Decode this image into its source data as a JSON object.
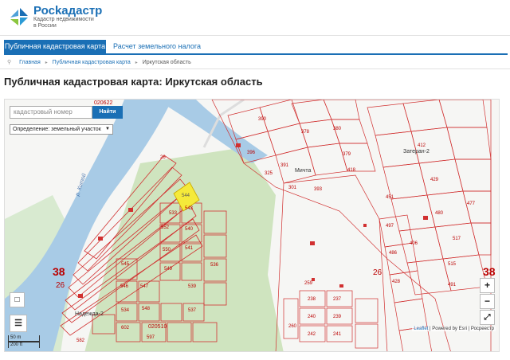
{
  "header": {
    "logo_title": "Росkадастр",
    "logo_sub_1": "Кадастр недвижимости",
    "logo_sub_2": "в России"
  },
  "nav": {
    "tabs": [
      {
        "label": "Публичная кадастровая карта",
        "active": true
      },
      {
        "label": "Расчет земельного налога",
        "active": false
      }
    ]
  },
  "breadcrumb": {
    "items": [
      "Главная",
      "Публичная кадастровая карта",
      "Иркутская область"
    ]
  },
  "page": {
    "title": "Публичная кадастровая карта: Иркутская область"
  },
  "map": {
    "search_placeholder": "кадастровый номер",
    "search_button": "Найти",
    "definition_label": "Определение:  земельный участок",
    "zoom_in": "+",
    "zoom_out": "−",
    "fullscreen": "⤢",
    "layers_icon": "layers-icon",
    "square_icon": "square-select-icon",
    "labels": {
      "big_left": "38",
      "big_left_sub": "26",
      "big_mid_sub": "26",
      "big_right": "38",
      "big_right_sub": "26",
      "top_code": "020622",
      "bottom_code": "020510",
      "river": "р. Китой",
      "village_1": "Мичта",
      "village_2": "Надежда-2",
      "village_3": "Затеран-2"
    },
    "scale_1": "50 m",
    "scale_2": "200 ft",
    "attribution_leaflet": "Leaflet",
    "attribution_rest": " | Powered by Esri | Росреестр",
    "parcels_top_left": [
      "26",
      "552",
      "543",
      "550",
      "540",
      "541",
      "537",
      "534",
      "539",
      "536",
      "533",
      "546",
      "547",
      "549",
      "548",
      "545"
    ],
    "parcels_right": [
      "390",
      "378",
      "380",
      "391",
      "379",
      "393",
      "396",
      "325",
      "301",
      "332",
      "331",
      "418",
      "412",
      "429",
      "477",
      "451",
      "480",
      "406",
      "497",
      "494",
      "486",
      "428",
      "419",
      "513",
      "530",
      "524",
      "515",
      "517",
      "491",
      "421",
      "409",
      "413",
      "401",
      "443"
    ],
    "parcels_bottom": [
      "259",
      "238",
      "237",
      "240",
      "239",
      "242",
      "241",
      "260",
      "602",
      "597",
      "582"
    ],
    "selected_parcel": "544"
  },
  "colors": {
    "accent": "#1a6fb5",
    "parcel_line": "#d13030",
    "selected_fill": "#f5ea3a",
    "river": "#a8cbe6",
    "forest": "#cfe4bf"
  }
}
